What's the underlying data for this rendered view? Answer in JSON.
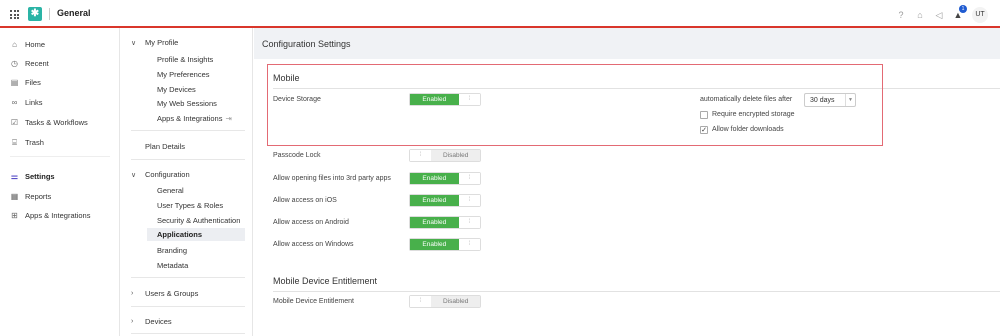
{
  "header": {
    "app_title": "General",
    "logo_glyph": "✱",
    "notification_count": "1",
    "avatar_initials": "UT",
    "accent_color": "#d9362b",
    "icons": [
      "grid-icon",
      "help-icon",
      "gift-icon",
      "megaphone-icon",
      "bell-icon"
    ]
  },
  "leftnav": {
    "items": [
      {
        "label": "Home",
        "icon": "home-icon",
        "glyph": "⌂"
      },
      {
        "label": "Recent",
        "icon": "clock-icon",
        "glyph": "◷"
      },
      {
        "label": "Files",
        "icon": "file-icon",
        "glyph": "▤"
      },
      {
        "label": "Links",
        "icon": "link-icon",
        "glyph": "∞"
      },
      {
        "label": "Tasks & Workflows",
        "icon": "tasks-icon",
        "glyph": "☑"
      },
      {
        "label": "Trash",
        "icon": "trash-icon",
        "glyph": "🗑"
      },
      {
        "label": "Settings",
        "icon": "settings-icon",
        "glyph": "⚌"
      },
      {
        "label": "Reports",
        "icon": "reports-icon",
        "glyph": "▦"
      },
      {
        "label": "Apps & Integrations",
        "icon": "apps-icon",
        "glyph": "⊞"
      }
    ]
  },
  "subnav": {
    "my_profile": "My Profile",
    "profile_items": [
      "Profile & Insights",
      "My Preferences",
      "My Devices",
      "My Web Sessions",
      "Apps & Integrations"
    ],
    "plan_details": "Plan Details",
    "configuration": "Configuration",
    "config_items": [
      "General",
      "User Types & Roles",
      "Security & Authentication",
      "Applications",
      "Branding",
      "Metadata"
    ],
    "users_groups": "Users & Groups",
    "devices": "Devices"
  },
  "main": {
    "title": "Configuration Settings",
    "mobile_section": "Mobile",
    "rows": [
      {
        "label": "Device Storage",
        "state": "Enabled"
      },
      {
        "label": "Passcode Lock",
        "state": "Disabled"
      },
      {
        "label": "Allow opening files into 3rd party apps",
        "state": "Enabled"
      },
      {
        "label": "Allow access on iOS",
        "state": "Enabled"
      },
      {
        "label": "Allow access on Android",
        "state": "Enabled"
      },
      {
        "label": "Allow access on Windows",
        "state": "Enabled"
      }
    ],
    "auto_delete_label": "automatically delete files after",
    "auto_delete_value": "30 days",
    "require_encrypted": "Require encrypted storage",
    "allow_folder_downloads": "Allow folder downloads",
    "entitlement_section": "Mobile Device Entitlement",
    "entitlement_row": {
      "label": "Mobile Device Entitlement",
      "state": "Disabled"
    }
  }
}
